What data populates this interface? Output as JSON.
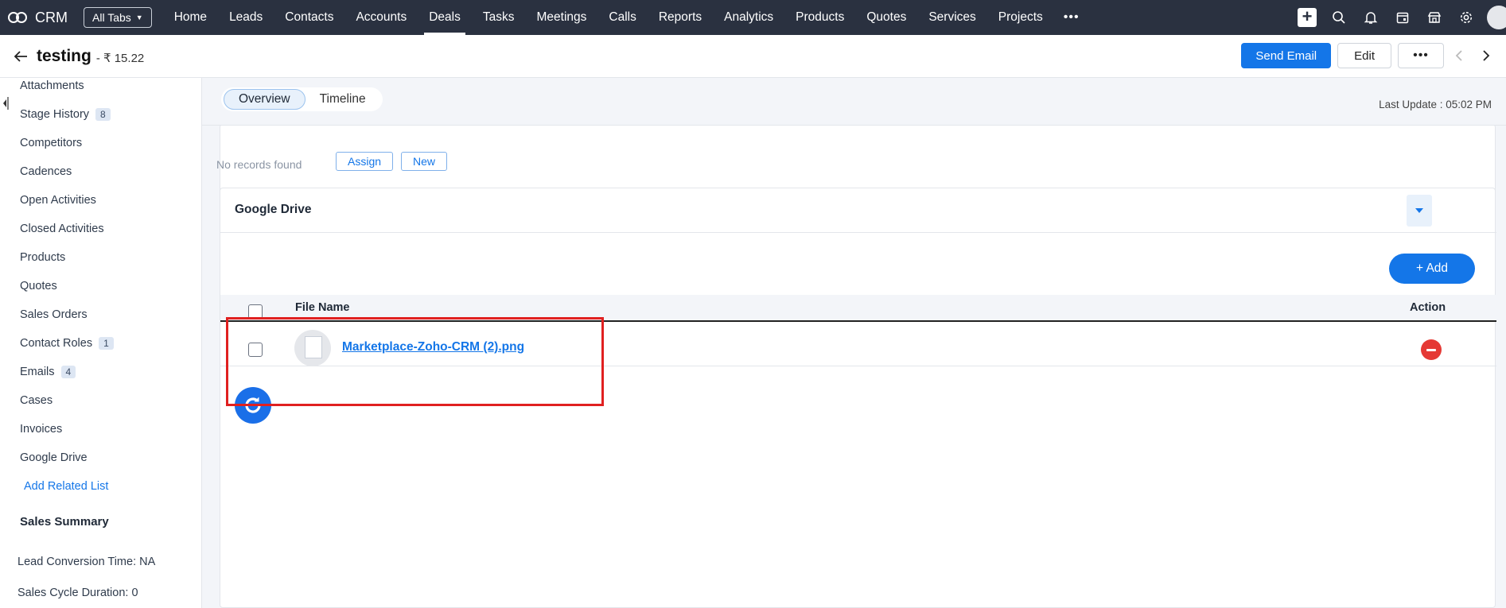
{
  "nav": {
    "brand": "CRM",
    "all_tabs": "All Tabs",
    "tabs": [
      "Home",
      "Leads",
      "Contacts",
      "Accounts",
      "Deals",
      "Tasks",
      "Meetings",
      "Calls",
      "Reports",
      "Analytics",
      "Products",
      "Quotes",
      "Services",
      "Projects"
    ],
    "active_tab": "Deals",
    "more": "•••",
    "icons": [
      "plus-icon",
      "search-icon",
      "bell-icon",
      "calendar-icon",
      "store-icon",
      "gear-icon",
      "avatar"
    ]
  },
  "record": {
    "title": "testing",
    "amount": "- ₹ 15.22",
    "send_email": "Send Email",
    "edit": "Edit",
    "more": "•••"
  },
  "sidebar": {
    "items": [
      {
        "label": "Attachments",
        "badge": ""
      },
      {
        "label": "Stage History",
        "badge": "8"
      },
      {
        "label": "Competitors",
        "badge": ""
      },
      {
        "label": "Cadences",
        "badge": ""
      },
      {
        "label": "Open Activities",
        "badge": ""
      },
      {
        "label": "Closed Activities",
        "badge": ""
      },
      {
        "label": "Products",
        "badge": ""
      },
      {
        "label": "Quotes",
        "badge": ""
      },
      {
        "label": "Sales Orders",
        "badge": ""
      },
      {
        "label": "Contact Roles",
        "badge": "1"
      },
      {
        "label": "Emails",
        "badge": "4"
      },
      {
        "label": "Cases",
        "badge": ""
      },
      {
        "label": "Invoices",
        "badge": ""
      },
      {
        "label": "Google Drive",
        "badge": ""
      }
    ],
    "add_related": "Add Related List",
    "summary_title": "Sales Summary",
    "lead_conversion": "Lead Conversion Time: NA",
    "sales_cycle": "Sales Cycle Duration: 0"
  },
  "main": {
    "tabs": [
      "Overview",
      "Timeline"
    ],
    "active_tab": "Overview",
    "last_update": "Last Update : 05:02 PM",
    "no_records": "No records found",
    "assign": "Assign",
    "new": "New",
    "google_drive": {
      "title": "Google Drive",
      "add": "+ Add",
      "col_file": "File Name",
      "col_action": "Action",
      "files": [
        {
          "name": "Marketplace-Zoho-CRM (2).png"
        }
      ]
    }
  },
  "colors": {
    "nav_bg": "#2a3140",
    "primary": "#1476e8",
    "danger": "#e53935",
    "highlight": "#e02020"
  }
}
